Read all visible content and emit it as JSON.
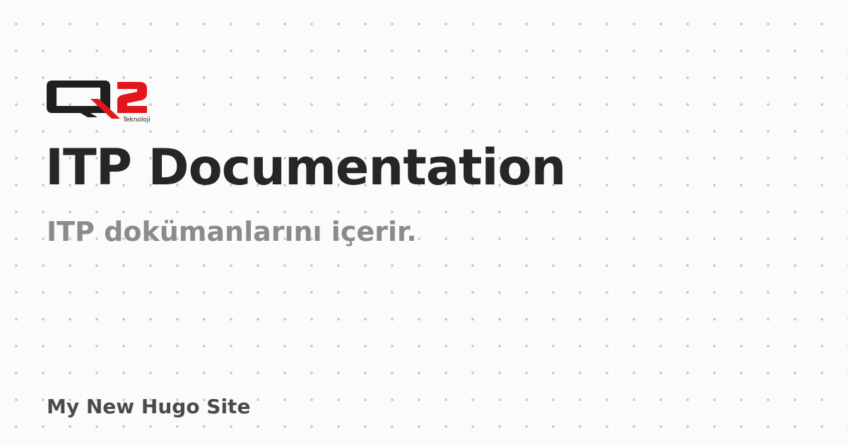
{
  "logo": {
    "icon": "q2-teknoloji-logo",
    "text_tagline": "Teknoloji",
    "colors": {
      "dark": "#1f1f1f",
      "accent": "#e3171b"
    }
  },
  "card": {
    "title": "ITP Documentation",
    "subtitle": "ITP dokümanlarını içerir.",
    "site_name": "My New Hugo Site"
  },
  "colors": {
    "background": "#fbfbfb",
    "dots": "#c8c8c8",
    "title": "#262626",
    "subtitle": "#8b8b8b",
    "site_name": "#4a4a4a"
  }
}
